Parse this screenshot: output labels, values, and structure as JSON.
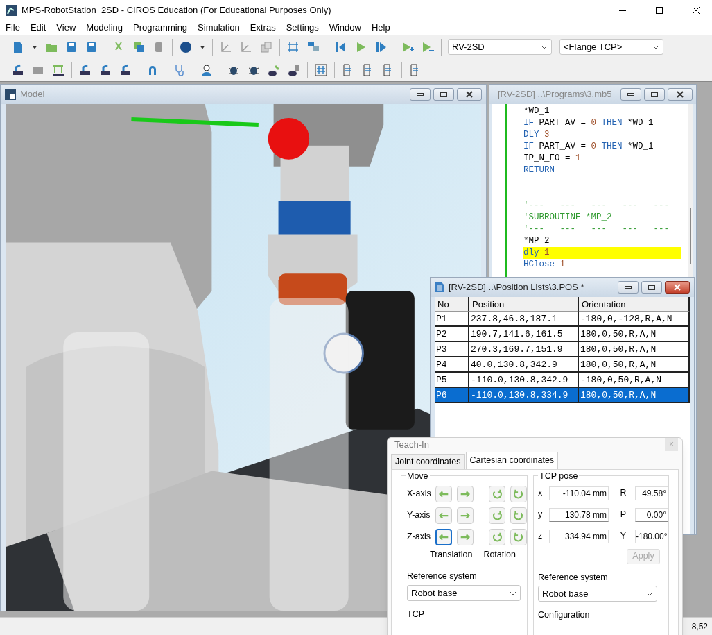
{
  "window": {
    "title": "MPS-RobotStation_2SD - CIROS Education (For Educational Purposes Only)"
  },
  "menu": [
    "File",
    "Edit",
    "View",
    "Modeling",
    "Programming",
    "Simulation",
    "Extras",
    "Settings",
    "Window",
    "Help"
  ],
  "toolbar": {
    "robot_select": "RV-2SD",
    "tcp_select": "<Flange TCP>"
  },
  "model_window": {
    "title": "Model",
    "active": false
  },
  "program_window": {
    "title": "[RV-2SD] ..\\Programs\\3.mb5",
    "active": false,
    "lines": [
      {
        "kind": "code",
        "highlighted": false,
        "tokens": [
          {
            "text": "*WD_1",
            "kind": "plain"
          }
        ]
      },
      {
        "kind": "code",
        "highlighted": false,
        "tokens": [
          {
            "text": "IF ",
            "kind": "keyword"
          },
          {
            "text": "PART_AV = ",
            "kind": "plain"
          },
          {
            "text": "0",
            "kind": "number"
          },
          {
            "text": " THEN ",
            "kind": "keyword"
          },
          {
            "text": "*WD_1",
            "kind": "plain"
          }
        ]
      },
      {
        "kind": "code",
        "highlighted": false,
        "tokens": [
          {
            "text": "DLY ",
            "kind": "keyword"
          },
          {
            "text": "3",
            "kind": "number"
          }
        ]
      },
      {
        "kind": "code",
        "highlighted": false,
        "tokens": [
          {
            "text": "IF ",
            "kind": "keyword"
          },
          {
            "text": "PART_AV = ",
            "kind": "plain"
          },
          {
            "text": "0",
            "kind": "number"
          },
          {
            "text": " THEN ",
            "kind": "keyword"
          },
          {
            "text": "*WD_1",
            "kind": "plain"
          }
        ]
      },
      {
        "kind": "code",
        "highlighted": false,
        "tokens": [
          {
            "text": "IP_N_FO = ",
            "kind": "plain"
          },
          {
            "text": "1",
            "kind": "number"
          }
        ]
      },
      {
        "kind": "code",
        "highlighted": false,
        "tokens": [
          {
            "text": "RETURN",
            "kind": "keyword"
          }
        ]
      },
      {
        "kind": "blank"
      },
      {
        "kind": "blank"
      },
      {
        "kind": "code",
        "highlighted": false,
        "tokens": [
          {
            "text": "'---   ---   ---   ---   ---",
            "kind": "comment"
          }
        ]
      },
      {
        "kind": "code",
        "highlighted": false,
        "tokens": [
          {
            "text": "'SUBROUTINE *MP_2",
            "kind": "comment"
          }
        ]
      },
      {
        "kind": "code",
        "highlighted": false,
        "tokens": [
          {
            "text": "'---   ---   ---   ---   ---",
            "kind": "comment"
          }
        ]
      },
      {
        "kind": "code",
        "highlighted": false,
        "tokens": [
          {
            "text": "*MP_2",
            "kind": "plain"
          }
        ]
      },
      {
        "kind": "code",
        "highlighted": true,
        "tokens": [
          {
            "text": "dly ",
            "kind": "keyword"
          },
          {
            "text": "1",
            "kind": "number"
          }
        ]
      },
      {
        "kind": "code",
        "highlighted": false,
        "tokens": [
          {
            "text": "HClose ",
            "kind": "keyword"
          },
          {
            "text": "1",
            "kind": "number"
          }
        ]
      }
    ]
  },
  "position_window": {
    "title": "[RV-2SD] ..\\Position Lists\\3.POS *",
    "active": true,
    "columns": [
      "No",
      "Position",
      "Orientation"
    ],
    "rows": [
      {
        "cells": [
          "P1",
          "237.8,46.8,187.1",
          "-180,0,-128,R,A,N"
        ],
        "selected": false
      },
      {
        "cells": [
          "P2",
          "190.7,141.6,161.5",
          "180,0,50,R,A,N"
        ],
        "selected": false
      },
      {
        "cells": [
          "P3",
          "270.3,169.7,151.9",
          "180,0,50,R,A,N"
        ],
        "selected": false
      },
      {
        "cells": [
          "P4",
          "40.0,130.8,342.9",
          "180,0,50,R,A,N"
        ],
        "selected": false
      },
      {
        "cells": [
          "P5",
          "-110.0,130.8,342.9",
          "-180,0,50,R,A,N"
        ],
        "selected": false
      },
      {
        "cells": [
          "P6",
          "-110.0,130.8,334.9",
          "180,0,50,R,A,N"
        ],
        "selected": true
      }
    ]
  },
  "teach_in": {
    "title": "Teach-In",
    "close": "×",
    "tabs": [
      {
        "label": "Joint coordinates",
        "selected": false
      },
      {
        "label": "Cartesian coordinates",
        "selected": true
      }
    ],
    "move": {
      "title": "Move",
      "axes": [
        {
          "label": "X-axis",
          "focused": false
        },
        {
          "label": "Y-axis",
          "focused": false
        },
        {
          "label": "Z-axis",
          "focused": true
        }
      ],
      "translation_label": "Translation",
      "rotation_label": "Rotation",
      "reference_label": "Reference system",
      "reference_value": "Robot base",
      "tcp_label": "TCP"
    },
    "pose": {
      "title": "TCP pose",
      "position": [
        {
          "label": "x",
          "value": "-110.04 mm"
        },
        {
          "label": "y",
          "value": "130.78 mm"
        },
        {
          "label": "z",
          "value": "334.94 mm"
        }
      ],
      "orientation": [
        {
          "label": "R",
          "value": "49.58°"
        },
        {
          "label": "P",
          "value": "0.00°"
        },
        {
          "label": "Y",
          "value": "-180.00°"
        }
      ],
      "apply": {
        "label": "Apply",
        "disabled": true
      },
      "reference_label": "Reference system",
      "reference_value": "Robot base",
      "configuration_label": "Configuration"
    }
  },
  "status_bar": {
    "value": "8,52"
  }
}
